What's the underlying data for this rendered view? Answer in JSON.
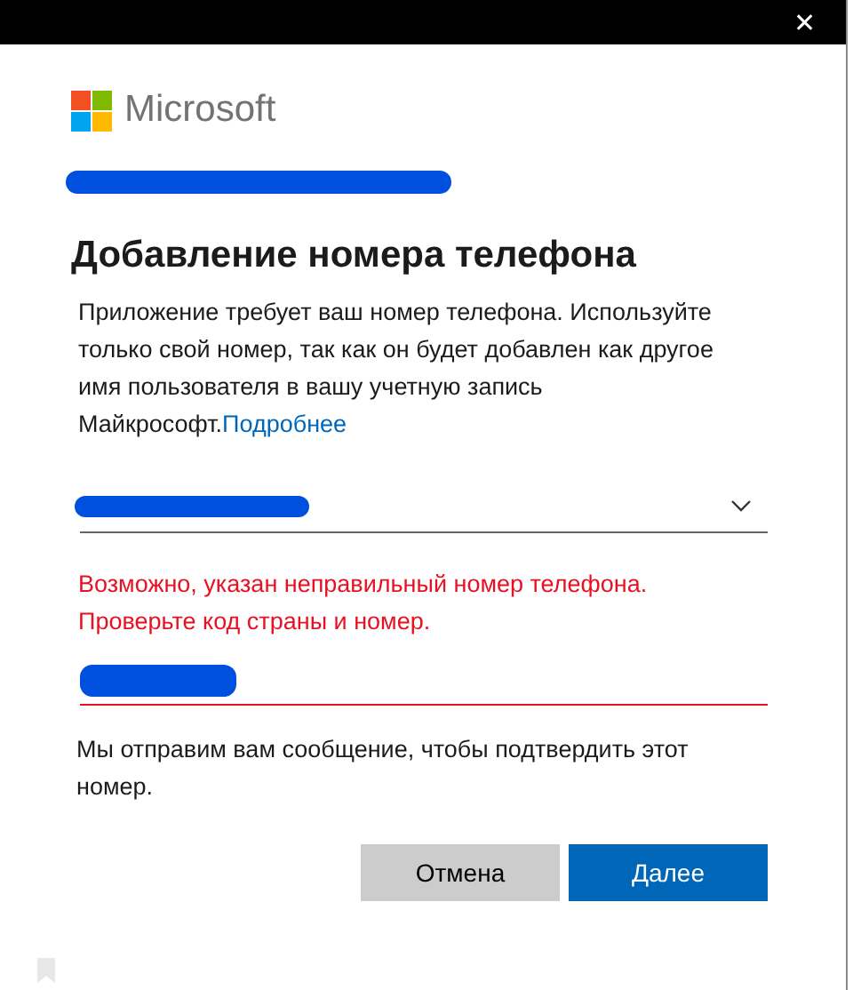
{
  "window": {
    "close_glyph": "✕"
  },
  "brand": {
    "name": "Microsoft"
  },
  "title": "Добавление номера телефона",
  "description": {
    "text": "Приложение требует ваш номер телефона. Используйте только свой номер, так как он будет добавлен как другое имя пользователя в вашу учетную запись Майкрософт.",
    "link": "Подробнее"
  },
  "country_select": {
    "redacted": true
  },
  "error_message": "Возможно, указан неправильный номер телефона. Проверьте код страны и номер.",
  "phone_field": {
    "redacted": true,
    "error": true
  },
  "note": "Мы отправим вам сообщение, чтобы подтвердить этот номер.",
  "buttons": [
    {
      "label": "Отмена",
      "kind": "secondary"
    },
    {
      "label": "Далее",
      "kind": "primary"
    }
  ]
}
